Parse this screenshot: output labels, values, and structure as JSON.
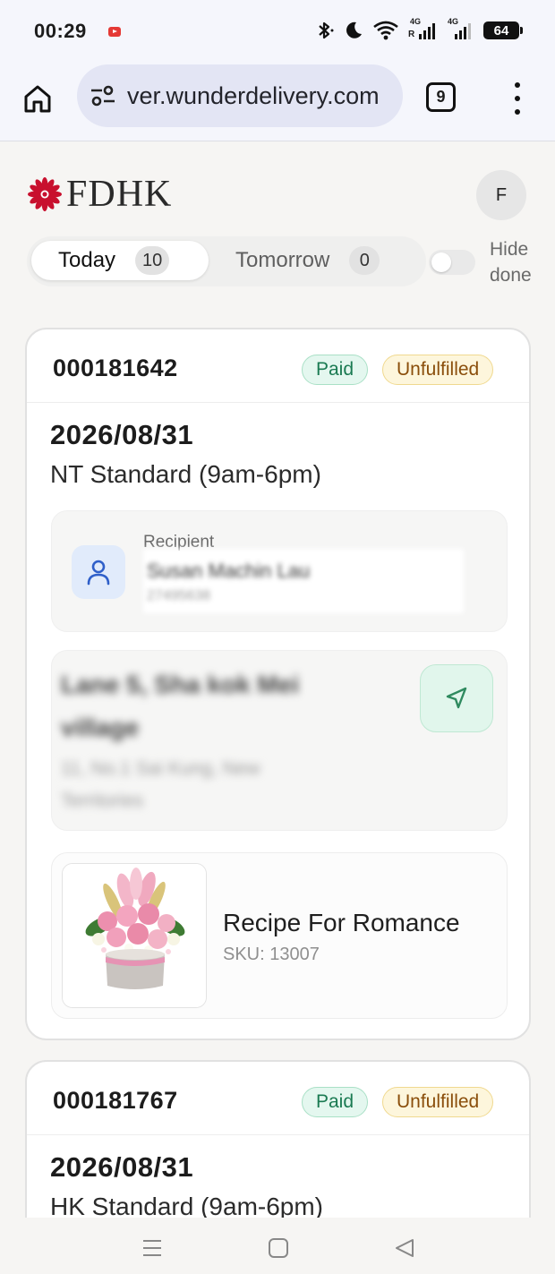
{
  "status_bar": {
    "time": "00:29",
    "network_type_1": "4G",
    "roaming": "R",
    "network_type_2": "4G",
    "battery": "64",
    "icons": [
      "screen-record-icon",
      "bluetooth-icon",
      "moon-icon",
      "wifi-icon",
      "signal-icon",
      "signal-icon",
      "battery-icon"
    ]
  },
  "browser": {
    "url": "ver.wunderdelivery.com",
    "tab_count": "9",
    "icons": [
      "home-icon",
      "site-info-icon",
      "tabs-icon",
      "more-vert-icon"
    ]
  },
  "header": {
    "logo_text": "FDHK",
    "logo_color": "#c8102e",
    "avatar_initial": "F"
  },
  "tabs": [
    {
      "label": "Today",
      "count": "10",
      "selected": true
    },
    {
      "label": "Tomorrow",
      "count": "0",
      "selected": false
    }
  ],
  "hide_done": {
    "label_1": "Hide",
    "label_2": "done",
    "enabled": false
  },
  "orders": [
    {
      "order_number": "000181642",
      "payment_status": "Paid",
      "fulfillment_status": "Unfulfilled",
      "date": "2026/08/31",
      "service": "NT Standard (9am-6pm)",
      "recipient_label": "Recipient",
      "recipient_name": "Susan Machin Lau",
      "recipient_phone": "27495638",
      "address_line_1a": "Lane 5, Sha kok Mei",
      "address_line_1b": "village",
      "address_line_2a": "11, No.1 Sai Kung, New",
      "address_line_2b": "Territories",
      "product_name": "Recipe For Romance",
      "product_sku": "SKU: 13007"
    },
    {
      "order_number": "000181767",
      "payment_status": "Paid",
      "fulfillment_status": "Unfulfilled",
      "date": "2026/08/31",
      "service": "HK Standard (9am-6pm)"
    }
  ],
  "colors": {
    "paid_bg": "#e4f7ef",
    "paid_text": "#1a7a52",
    "unfulfilled_bg": "#fdf6dc",
    "unfulfilled_text": "#8a4e0b",
    "accent_green": "#2f8a5f",
    "accent_blue": "#2f5fc9"
  },
  "system_nav": {
    "icons": [
      "recents-icon",
      "home-square-icon",
      "back-triangle-icon"
    ]
  }
}
